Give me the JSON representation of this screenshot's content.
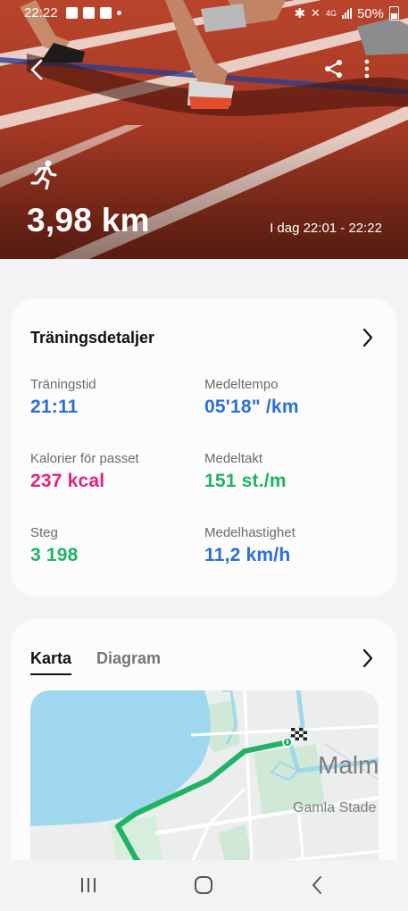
{
  "status_bar": {
    "time": "22:22",
    "network": "4G",
    "battery": "50%"
  },
  "hero": {
    "distance": "3,98 km",
    "datetime": "I dag 22:01 - 22:22",
    "activity_icon": "running-icon"
  },
  "details": {
    "title": "Träningsdetaljer",
    "metrics": [
      {
        "label": "Träningstid",
        "value": "21:11",
        "color": "#2b6fd6"
      },
      {
        "label": "Medeltempo",
        "value": "05'18\" /km",
        "color": "#2b6fd6"
      },
      {
        "label": "Kalorier för passet",
        "value": "237 kcal",
        "color": "#e0237f"
      },
      {
        "label": "Medeltakt",
        "value": "151 st./m",
        "color": "#1fb463"
      },
      {
        "label": "Steg",
        "value": "3 198",
        "color": "#1fb463"
      },
      {
        "label": "Medelhastighet",
        "value": "11,2 km/h",
        "color": "#2b6fd6"
      }
    ]
  },
  "map_section": {
    "tabs": [
      "Karta",
      "Diagram"
    ],
    "active_tab": "Karta",
    "map_labels": {
      "city": "Malm",
      "district": "Gamla Stade"
    }
  },
  "colors": {
    "route": "#1fb463",
    "water": "#9fd7ef"
  }
}
